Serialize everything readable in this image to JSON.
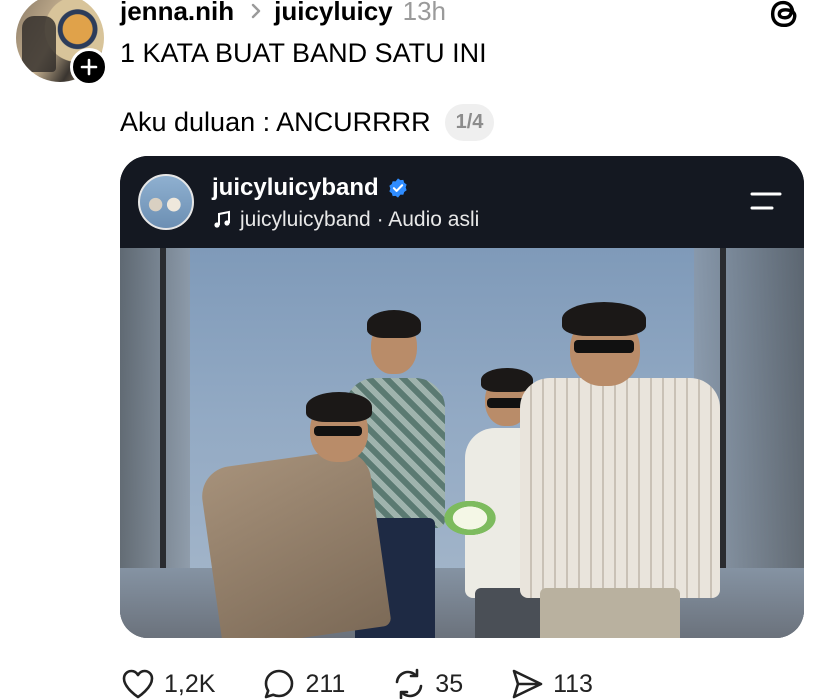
{
  "header": {
    "username": "jenna.nih",
    "reply_to": "juicyluicy",
    "timestamp": "13h"
  },
  "post": {
    "line1": "1 KATA BUAT BAND SATU INI",
    "line2": "Aku duluan : ANCURRRR",
    "page_indicator": "1/4"
  },
  "media": {
    "account": "juicyluicyband",
    "audio_label": "juicyluicyband · Audio asli"
  },
  "actions": {
    "likes": "1,2K",
    "replies": "211",
    "reposts": "35",
    "shares": "113"
  },
  "icons": [
    "add-icon",
    "chevron-right-icon",
    "threads-logo-icon",
    "verified-icon",
    "music-note-icon",
    "menu-icon",
    "heart-icon",
    "comment-icon",
    "repost-icon",
    "share-icon"
  ],
  "colors": {
    "verified": "#2f8cff",
    "media_header": "#141821",
    "muted": "#9a9a9a"
  }
}
